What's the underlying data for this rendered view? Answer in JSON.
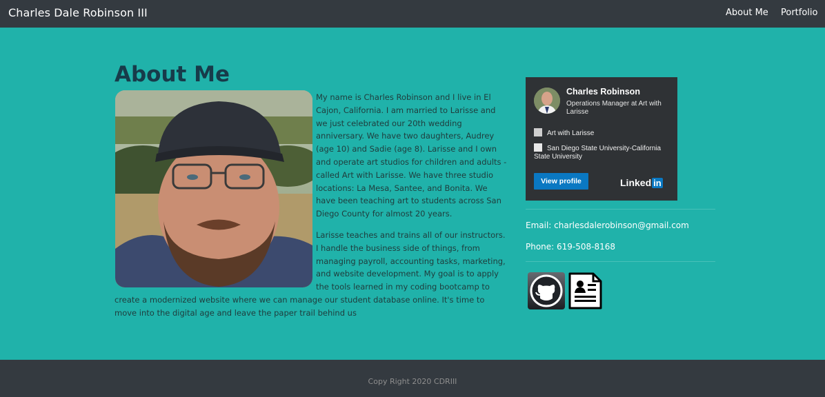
{
  "navbar": {
    "brand": "Charles Dale Robinson III",
    "links": [
      "About Me",
      "Portfolio"
    ]
  },
  "main": {
    "heading": "About Me",
    "photo_alt": "profile photo",
    "bio": [
      "My name is Charles Robinson and I live in El Cajon, California. I am married to Larisse and we just celebrated our 20th wedding anniversary. We have two daughters, Audrey (age 10) and Sadie (age 8). Larisse and I own and operate art studios for children and adults - called Art with Larisse. We have three studio locations: La Mesa, Santee, and Bonita. We have been teaching art to students across San Diego County for almost 20 years.",
      "Larisse teaches and trains all of our instructors. I handle the business side of things, from managing payroll, accounting tasks, marketing, and website development. My goal is to apply the tools learned in my coding bootcamp to create a modernized website where we can manage our student database online. It's time to move into the digital age and leave the paper trail behind us"
    ]
  },
  "linkedin_badge": {
    "name": "Charles Robinson",
    "headline": "Operations Manager at Art with Larisse",
    "company": "Art with Larisse",
    "school": "San Diego State University-California State University",
    "button_label": "View profile",
    "logo_text": "Linked",
    "logo_in": "in",
    "brand_color": "#0a78c2"
  },
  "contact": {
    "email": "Email: charlesdalerobinson@gmail.com",
    "phone": "Phone: 619-508-8168"
  },
  "icons": [
    "github-icon",
    "resume-icon"
  ],
  "footer": {
    "text": "Copy Right 2020 CDRIII"
  },
  "colors": {
    "background": "#20b2aa",
    "navbar": "#343a40",
    "heading": "#173b4a"
  }
}
